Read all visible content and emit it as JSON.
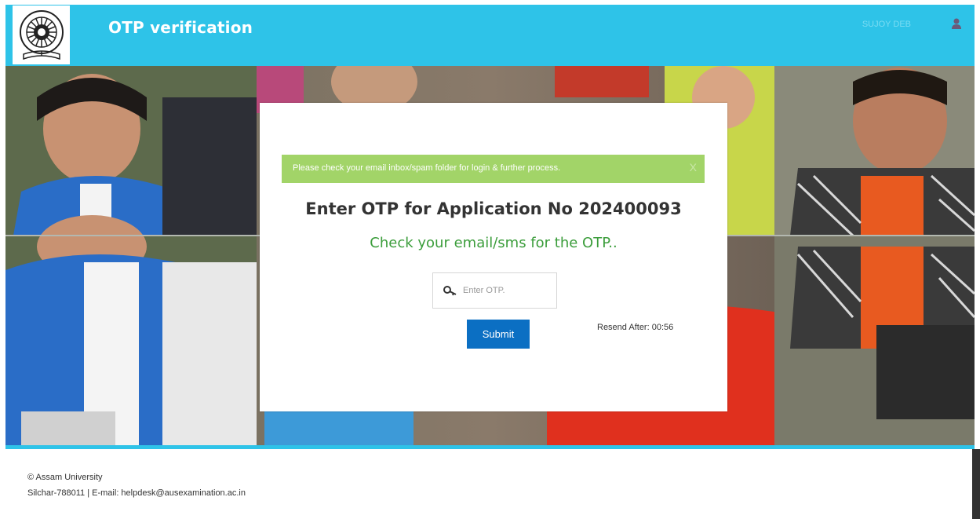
{
  "header": {
    "title": "OTP verification",
    "user_name": "SUJOY DEB",
    "user_icon": "user-icon",
    "logo_icon": "university-seal-logo",
    "bg_color": "#2ec3e8"
  },
  "alert": {
    "message": "Please check your email inbox/spam folder for login & further process.",
    "close_label": "X",
    "bg_color": "#a2d468"
  },
  "otp": {
    "heading": "Enter OTP for Application No 202400093",
    "subtitle": "Check your email/sms for the OTP..",
    "input_placeholder": "Enter OTP.",
    "input_value": "",
    "input_icon": "key-icon",
    "submit_label": "Submit",
    "resend_text": "Resend After: 00:56",
    "subtitle_color": "#3b9d3b",
    "button_color": "#0b6fc3"
  },
  "footer": {
    "copyright": "© Assam University",
    "address": "Silchar-788011 | E-mail: helpdesk@ausexamination.ac.in"
  }
}
